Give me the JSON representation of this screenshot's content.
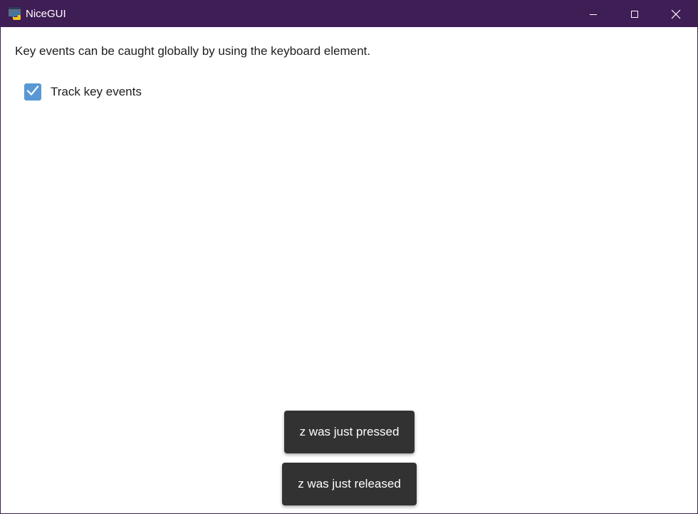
{
  "window": {
    "title": "NiceGUI",
    "app_icon": "python-icon",
    "controls": [
      "minimize-icon",
      "maximize-icon",
      "close-icon"
    ]
  },
  "main": {
    "description": "Key events can be caught globally by using the keyboard element.",
    "checkbox": {
      "label": "Track key events",
      "checked": true,
      "color": "#5898d4"
    }
  },
  "notifications": [
    {
      "text": "z was just pressed"
    },
    {
      "text": "z was just released"
    }
  ],
  "colors": {
    "titlebar": "#3f1d55",
    "toast": "#323232"
  }
}
